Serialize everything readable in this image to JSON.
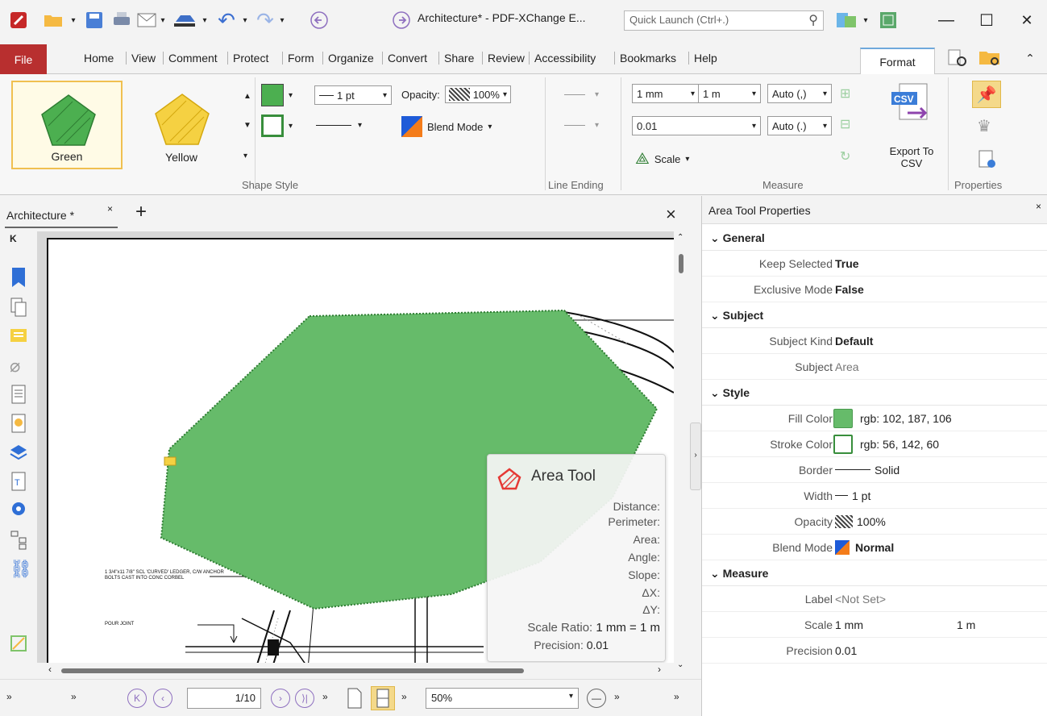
{
  "window": {
    "title": "Architecture* - PDF-XChange E...",
    "quick_launch_placeholder": "Quick Launch (Ctrl+.)",
    "min_label": "—",
    "max_label": "☐",
    "close_label": "✕"
  },
  "menu": {
    "file": "File",
    "items": [
      "Home",
      "View",
      "Comment",
      "Protect",
      "Form",
      "Organize",
      "Convert",
      "Share",
      "Review",
      "Accessibility",
      "Bookmarks",
      "Help"
    ],
    "format": "Format"
  },
  "ribbon": {
    "styles": [
      {
        "label": "Green",
        "color": "#4caf50"
      },
      {
        "label": "Yellow",
        "color": "#f5d142"
      }
    ],
    "line_width": "1 pt",
    "opacity_label": "Opacity:",
    "opacity_value": "100%",
    "blend_mode": "Blend Mode",
    "scale_from": "1 mm",
    "scale_to": "1 m",
    "precision": "0.01",
    "auto1": "Auto (,)",
    "auto2": "Auto (.)",
    "scale_btn": "Scale",
    "export_csv": "Export To\nCSV",
    "groups": {
      "shape_style": "Shape Style",
      "line_ending": "Line Ending",
      "measure": "Measure",
      "properties": "Properties"
    }
  },
  "doc": {
    "tab_title": "Architecture *",
    "tab_close": "×",
    "new_tab": "+",
    "close_doc": "×",
    "drawing_note_1": "1 3/4\"x11 7/8\" SCL 'CURVED' LEDGER, C/W ANCHOR BOLTS CAST INTO CONC CORBEL",
    "drawing_note_2": "POUR JOINT"
  },
  "area_popup": {
    "title": "Area Tool",
    "rows": [
      {
        "k": "Distance:",
        "v": ""
      },
      {
        "k": "Perimeter:",
        "v": ""
      },
      {
        "k": "Area:",
        "v": ""
      },
      {
        "k": "Angle:",
        "v": ""
      },
      {
        "k": "Slope:",
        "v": ""
      },
      {
        "k": "ΔX:",
        "v": ""
      },
      {
        "k": "ΔY:",
        "v": ""
      },
      {
        "k": "Scale Ratio:",
        "v": "1 mm = 1 m"
      },
      {
        "k": "Precision:",
        "v": "0.01"
      }
    ]
  },
  "bottom": {
    "page_value": "1/10",
    "zoom": "50%"
  },
  "props": {
    "title": "Area Tool Properties",
    "close": "×",
    "general": "General",
    "keep_selected_k": "Keep Selected",
    "keep_selected_v": "True",
    "exclusive_k": "Exclusive Mode",
    "exclusive_v": "False",
    "subject": "Subject",
    "subject_kind_k": "Subject Kind",
    "subject_kind_v": "Default",
    "subject_k": "Subject",
    "subject_v": "Area",
    "style": "Style",
    "fill_k": "Fill Color",
    "fill_v": "rgb: 102, 187, 106",
    "fill_color": "#66bb6a",
    "stroke_k": "Stroke Color",
    "stroke_v": "rgb: 56, 142, 60",
    "stroke_color": "#388e3c",
    "border_k": "Border",
    "border_v": "Solid",
    "width_k": "Width",
    "width_v": "1 pt",
    "opacity_k": "Opacity",
    "opacity_v": "100%",
    "blend_k": "Blend Mode",
    "blend_v": "Normal",
    "measure": "Measure",
    "label_k": "Label",
    "label_v": "<Not Set>",
    "scale_k": "Scale",
    "scale_v1": "1 mm",
    "scale_v2": "1 m",
    "precision_k": "Precision",
    "precision_v": "0.01"
  }
}
